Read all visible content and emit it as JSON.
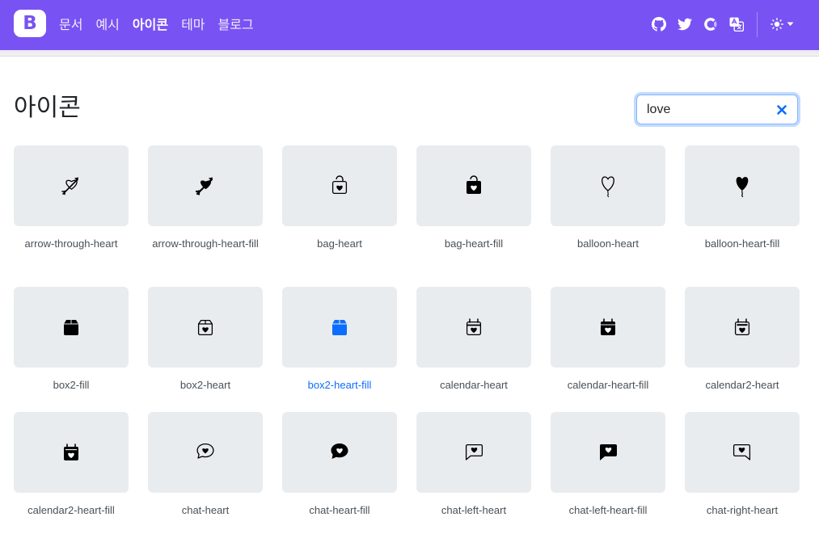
{
  "brand": {
    "letter": "B"
  },
  "nav": {
    "links": [
      "문서",
      "예시",
      "아이콘",
      "테마",
      "블로그"
    ],
    "active_index": 2,
    "icons": [
      "github-icon",
      "twitter-icon",
      "opencollective-icon",
      "translate-icon"
    ],
    "theme_icon": "sun-icon"
  },
  "page": {
    "title": "아이콘"
  },
  "search": {
    "value": "love"
  },
  "colors": {
    "navbar": "#7952f3",
    "tile": "#e9ecef",
    "accent": "#0d6efd"
  },
  "icons": [
    {
      "name": "arrow-through-heart",
      "style": "outline",
      "shape": "arrow-heart"
    },
    {
      "name": "arrow-through-heart-fill",
      "style": "fill",
      "shape": "arrow-heart"
    },
    {
      "name": "bag-heart",
      "style": "outline",
      "shape": "bag"
    },
    {
      "name": "bag-heart-fill",
      "style": "fill",
      "shape": "bag"
    },
    {
      "name": "balloon-heart",
      "style": "outline",
      "shape": "balloon"
    },
    {
      "name": "balloon-heart-fill",
      "style": "fill",
      "shape": "balloon"
    },
    {
      "name": "box2-fill",
      "style": "fill",
      "shape": "box"
    },
    {
      "name": "box2-heart",
      "style": "outline",
      "shape": "box-heart"
    },
    {
      "name": "box2-heart-fill",
      "style": "fill",
      "shape": "box-heart",
      "active": true
    },
    {
      "name": "calendar-heart",
      "style": "outline",
      "shape": "calendar"
    },
    {
      "name": "calendar-heart-fill",
      "style": "fill",
      "shape": "calendar"
    },
    {
      "name": "calendar2-heart",
      "style": "outline",
      "shape": "calendar2"
    },
    {
      "name": "calendar2-heart-fill",
      "style": "fill",
      "shape": "calendar2"
    },
    {
      "name": "chat-heart",
      "style": "outline",
      "shape": "chat"
    },
    {
      "name": "chat-heart-fill",
      "style": "fill",
      "shape": "chat"
    },
    {
      "name": "chat-left-heart",
      "style": "outline",
      "shape": "chat-left"
    },
    {
      "name": "chat-left-heart-fill",
      "style": "fill",
      "shape": "chat-left"
    },
    {
      "name": "chat-right-heart",
      "style": "outline",
      "shape": "chat-right"
    }
  ]
}
